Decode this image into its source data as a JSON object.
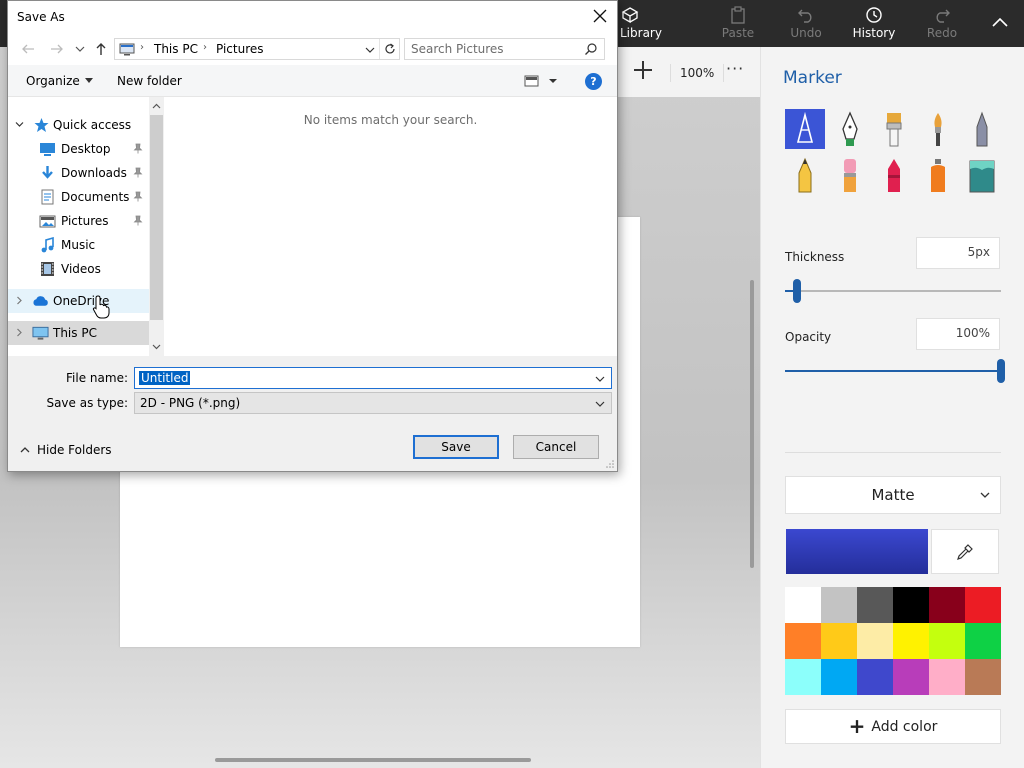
{
  "app": {
    "toolbar": {
      "library": "Library",
      "paste": "Paste",
      "undo": "Undo",
      "history": "History",
      "redo": "Redo"
    },
    "canvas_toolbar": {
      "zoom": "100%",
      "more": "···"
    },
    "panel": {
      "title": "Marker",
      "brushes": [
        "marker",
        "calligraphy-pen",
        "oil-brush",
        "watercolor",
        "pixel-pen",
        "pencil",
        "eraser",
        "crayon",
        "spray-can",
        "fill"
      ],
      "selected_brush": "marker",
      "thickness_label": "Thickness",
      "thickness_value": "5px",
      "thickness_level": 0.05,
      "opacity_label": "Opacity",
      "opacity_value": "100%",
      "opacity_level": 1.0,
      "finish": "Matte",
      "current_color": "#3b48d0",
      "swatches": [
        "#ffffff",
        "#c3c3c3",
        "#585858",
        "#000000",
        "#88001b",
        "#ec1c24",
        "#ff7f27",
        "#ffca18",
        "#fdeca6",
        "#fff200",
        "#c4ff0e",
        "#0ed145",
        "#8cfffb",
        "#00a8f3",
        "#3f48cc",
        "#b83dba",
        "#ffaec8",
        "#b97a56"
      ],
      "add_color": "Add color"
    }
  },
  "dialog": {
    "title": "Save As",
    "breadcrumb": [
      "This PC",
      "Pictures"
    ],
    "search_placeholder": "Search Pictures",
    "organize": "Organize",
    "new_folder": "New folder",
    "help": "?",
    "nav": {
      "quick_access": "Quick access",
      "items": [
        {
          "label": "Desktop",
          "icon": "desktop-icon",
          "pinned": true
        },
        {
          "label": "Downloads",
          "icon": "downloads-icon",
          "pinned": true
        },
        {
          "label": "Documents",
          "icon": "documents-icon",
          "pinned": true
        },
        {
          "label": "Pictures",
          "icon": "pictures-icon",
          "pinned": true
        },
        {
          "label": "Music",
          "icon": "music-icon",
          "pinned": false
        },
        {
          "label": "Videos",
          "icon": "videos-icon",
          "pinned": false
        }
      ],
      "onedrive": "OneDrive",
      "this_pc": "This PC"
    },
    "empty_message": "No items match your search.",
    "file_name_label": "File name:",
    "file_name_value": "Untitled",
    "save_type_label": "Save as type:",
    "save_type_value": "2D - PNG (*.png)",
    "hide_folders": "Hide Folders",
    "save": "Save",
    "cancel": "Cancel"
  },
  "colors": {
    "accent": "#1e6fd2",
    "selection": "#0063c4",
    "panel_accent": "#1f5fa8"
  }
}
